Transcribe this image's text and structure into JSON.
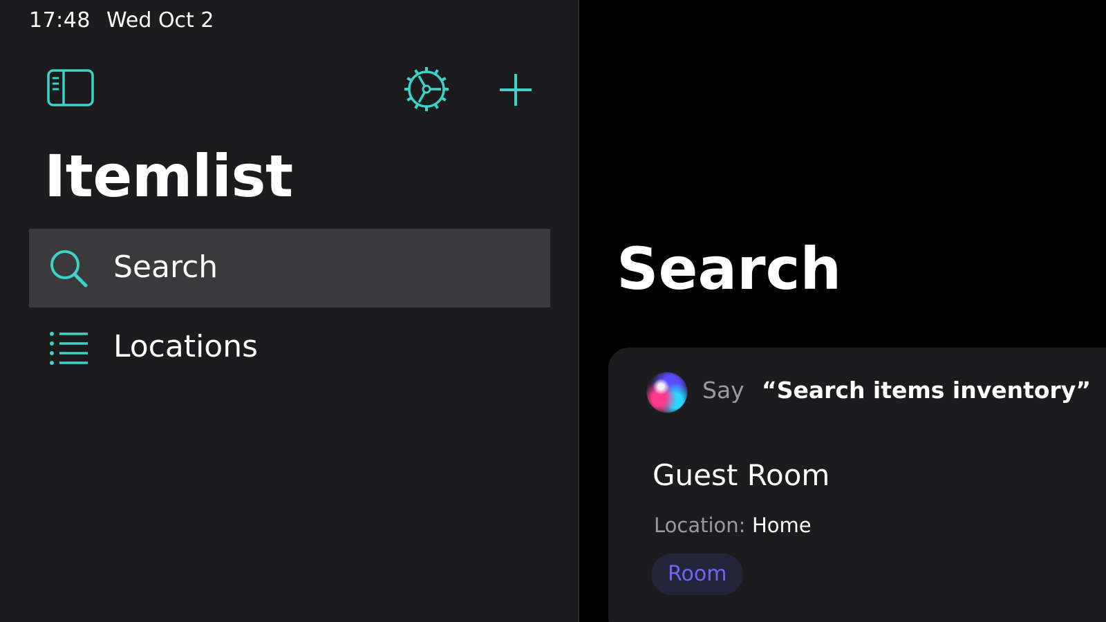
{
  "status_bar": {
    "time": "17:48",
    "date": "Wed Oct 2"
  },
  "colors": {
    "accent": "#3cd3c9",
    "tag_text": "#6e66f2",
    "sidebar_bg": "#1c1c1e",
    "selected_bg": "#3a3a3c"
  },
  "sidebar": {
    "title": "Itemlist",
    "toolbar": {
      "toggle_icon": "sidebar-left-icon",
      "settings_icon": "gear-icon",
      "add_icon": "plus-icon"
    },
    "items": [
      {
        "label": "Search",
        "icon": "magnifying-glass-icon",
        "selected": true
      },
      {
        "label": "Locations",
        "icon": "list-bullet-icon",
        "selected": false
      }
    ]
  },
  "detail": {
    "title": "Search",
    "siri": {
      "prefix": "Say",
      "phrase": "“Search items inventory”"
    },
    "result": {
      "name": "Guest Room",
      "location_label": "Location:",
      "location_value": "Home",
      "tag": "Room"
    }
  }
}
